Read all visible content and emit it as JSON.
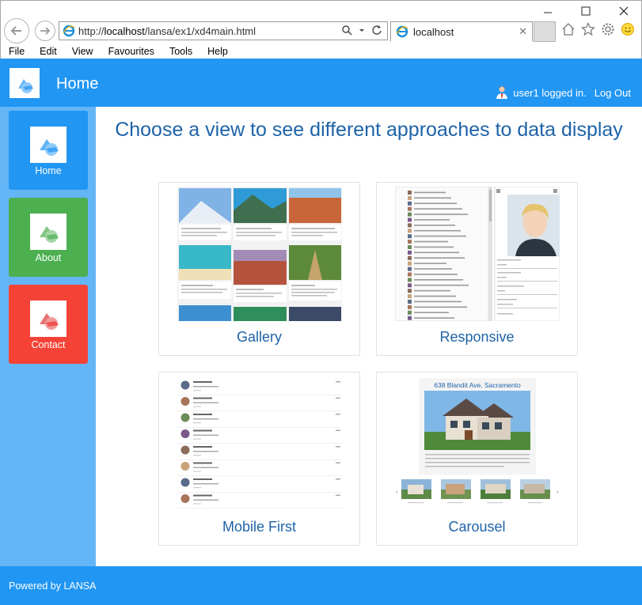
{
  "browser": {
    "address_url_prefix": "http://",
    "address_url_host": "localhost",
    "address_url_path": "/lansa/ex1/xd4main.html",
    "tab_title": "localhost",
    "menu": [
      "File",
      "Edit",
      "View",
      "Favourites",
      "Tools",
      "Help"
    ]
  },
  "header": {
    "title": "Home",
    "user_text": "user1 logged in.",
    "logout_label": "Log Out"
  },
  "sidebar": {
    "items": [
      {
        "label": "Home",
        "color": "#2196f3"
      },
      {
        "label": "About",
        "color": "#4caf50"
      },
      {
        "label": "Contact",
        "color": "#f44336"
      }
    ]
  },
  "main": {
    "title": "Choose a view to see different approaches to data display",
    "cards": [
      {
        "label": "Gallery"
      },
      {
        "label": "Responsive"
      },
      {
        "label": "Mobile First"
      },
      {
        "label": "Carousel"
      }
    ],
    "carousel_thumb_title": "638 Blandit Ave, Sacramento"
  },
  "footer": {
    "text": "Powered by LANSA"
  },
  "colors": {
    "primary": "#2196f3",
    "sidebar": "#64b5f6",
    "title": "#1e63a8"
  }
}
